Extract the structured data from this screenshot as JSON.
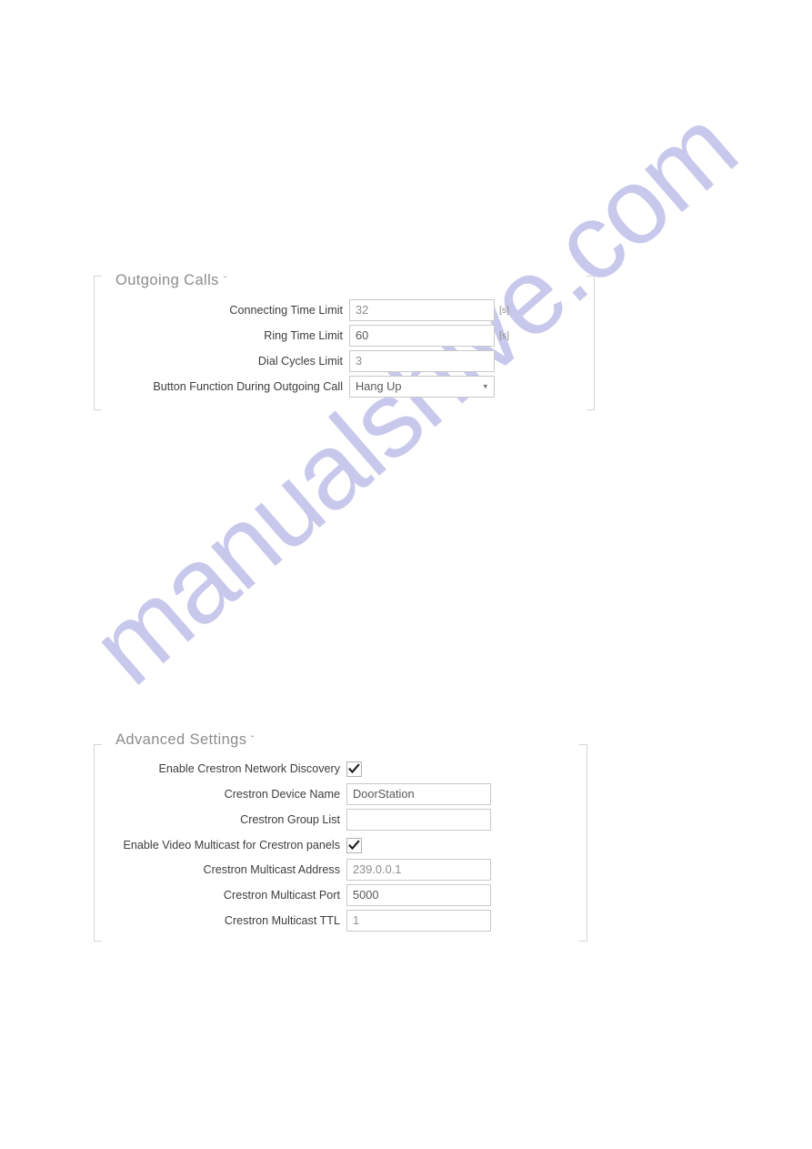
{
  "watermark": {
    "text": "manualshive.com",
    "color": "#c6c6ec"
  },
  "sections": [
    {
      "id": "outgoing-calls",
      "title": "Outgoing Calls",
      "caret": "ˇ",
      "rows": [
        {
          "label": "Connecting Time Limit",
          "type": "text",
          "value": "32",
          "unit": "[s]"
        },
        {
          "label": "Ring Time Limit",
          "type": "text",
          "value": "60",
          "unit": "[s]"
        },
        {
          "label": "Dial Cycles Limit",
          "type": "text",
          "value": "3",
          "unit": ""
        },
        {
          "label": "Button Function During Outgoing Call",
          "type": "select",
          "value": "Hang Up",
          "unit": "",
          "options": [
            "Hang Up"
          ]
        }
      ]
    },
    {
      "id": "advanced-settings",
      "title": "Advanced Settings",
      "caret": "ˇ",
      "rows": [
        {
          "label": "Enable Crestron Network Discovery",
          "type": "checkbox",
          "value": "checked",
          "unit": ""
        },
        {
          "label": "Crestron Device Name",
          "type": "text",
          "value": "DoorStation",
          "unit": ""
        },
        {
          "label": "Crestron Group List",
          "type": "text",
          "value": "",
          "unit": ""
        },
        {
          "label": "Enable Video Multicast for Crestron panels",
          "type": "checkbox",
          "value": "checked",
          "unit": ""
        },
        {
          "label": "Crestron Multicast Address",
          "type": "text",
          "value": "239.0.0.1",
          "unit": ""
        },
        {
          "label": "Crestron Multicast Port",
          "type": "text",
          "value": "5000",
          "unit": ""
        },
        {
          "label": "Crestron Multicast TTL",
          "type": "text",
          "value": "1",
          "unit": ""
        }
      ]
    }
  ]
}
